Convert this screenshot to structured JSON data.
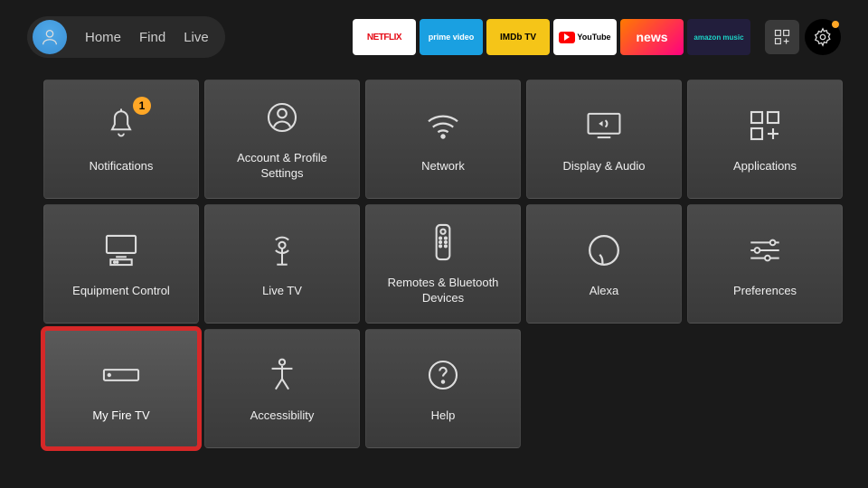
{
  "nav": {
    "home": "Home",
    "find": "Find",
    "live": "Live"
  },
  "apps": {
    "netflix": "NETFLIX",
    "prime": "prime video",
    "imdb": "IMDb TV",
    "youtube": "YouTube",
    "news": "news",
    "amusic": "amazon music"
  },
  "tiles": {
    "notifications": {
      "label": "Notifications",
      "badge": "1"
    },
    "account": {
      "label": "Account & Profile Settings"
    },
    "network": {
      "label": "Network"
    },
    "display": {
      "label": "Display & Audio"
    },
    "applications": {
      "label": "Applications"
    },
    "equipment": {
      "label": "Equipment Control"
    },
    "livetv": {
      "label": "Live TV"
    },
    "remotes": {
      "label": "Remotes & Bluetooth Devices"
    },
    "alexa": {
      "label": "Alexa"
    },
    "preferences": {
      "label": "Preferences"
    },
    "myfiretv": {
      "label": "My Fire TV"
    },
    "accessibility": {
      "label": "Accessibility"
    },
    "help": {
      "label": "Help"
    }
  }
}
